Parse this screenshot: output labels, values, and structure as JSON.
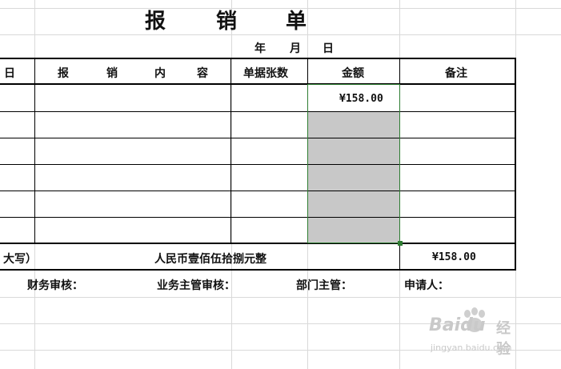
{
  "title": {
    "chars": [
      "报",
      "销",
      "单"
    ]
  },
  "date": {
    "year": "年",
    "month": "月",
    "day": "日"
  },
  "header": {
    "col_day": "日",
    "col_content_chars": [
      "报",
      "销",
      "内",
      "容"
    ],
    "col_receipts": "单据张数",
    "col_amount": "金额",
    "col_notes": "备注"
  },
  "rows": [
    {
      "amount": "¥158.00"
    },
    {
      "amount": ""
    },
    {
      "amount": ""
    },
    {
      "amount": ""
    },
    {
      "amount": ""
    },
    {
      "amount": ""
    }
  ],
  "total_row": {
    "label_fragment": "大写）",
    "amount_in_words": "人民币壹佰伍拾捌元整",
    "total_amount": "¥158.00"
  },
  "signatures": {
    "finance_review": "财务审核：",
    "business_supervisor_review": "业务主管审核：",
    "department_head": "部门主管：",
    "applicant": "申请人："
  },
  "watermark": {
    "brand": "Baidu",
    "brand_cn": "经验",
    "url": "jingyan.baidu.com"
  },
  "colors": {
    "selection_fill": "#c8c8c8",
    "selection_border": "#2e7d32",
    "grid_line": "#d9d9d9"
  }
}
